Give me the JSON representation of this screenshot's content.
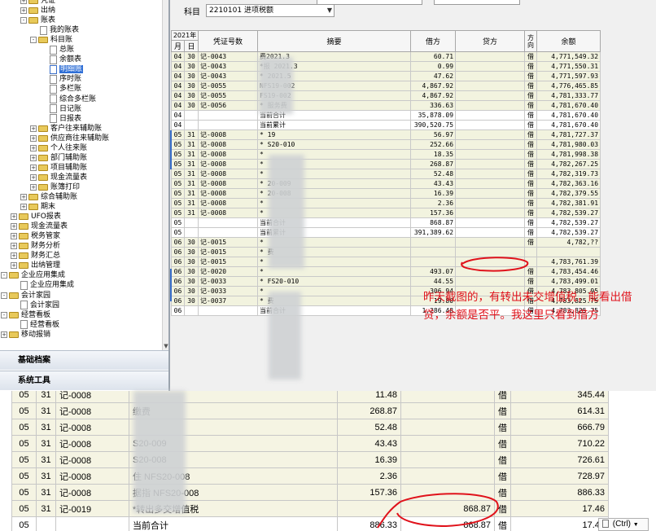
{
  "tree": {
    "items": [
      {
        "label": "凭证",
        "level": 2,
        "expander": "+",
        "icon": "folder-icon"
      },
      {
        "label": "出纳",
        "level": 2,
        "expander": "+",
        "icon": "folder-icon"
      },
      {
        "label": "账表",
        "level": 2,
        "expander": "-",
        "icon": "folder-icon"
      },
      {
        "label": "我的账表",
        "level": 3,
        "expander": "",
        "icon": "document-icon"
      },
      {
        "label": "科目账",
        "level": 3,
        "expander": "-",
        "icon": "folder-icon"
      },
      {
        "label": "总账",
        "level": 4,
        "expander": "",
        "icon": "document-icon"
      },
      {
        "label": "余额表",
        "level": 4,
        "expander": "",
        "icon": "document-icon"
      },
      {
        "label": "明细账",
        "level": 4,
        "expander": "",
        "icon": "document-icon",
        "selected": true
      },
      {
        "label": "序时账",
        "level": 4,
        "expander": "",
        "icon": "document-icon"
      },
      {
        "label": "多栏账",
        "level": 4,
        "expander": "",
        "icon": "document-icon"
      },
      {
        "label": "综合多栏账",
        "level": 4,
        "expander": "",
        "icon": "document-icon"
      },
      {
        "label": "日记账",
        "level": 4,
        "expander": "",
        "icon": "document-icon"
      },
      {
        "label": "日报表",
        "level": 4,
        "expander": "",
        "icon": "document-icon"
      },
      {
        "label": "客户往来辅助账",
        "level": 3,
        "expander": "+",
        "icon": "folder-icon"
      },
      {
        "label": "供应商往来辅助账",
        "level": 3,
        "expander": "+",
        "icon": "folder-icon"
      },
      {
        "label": "个人往来账",
        "level": 3,
        "expander": "+",
        "icon": "folder-icon"
      },
      {
        "label": "部门辅助账",
        "level": 3,
        "expander": "+",
        "icon": "folder-icon"
      },
      {
        "label": "项目辅助账",
        "level": 3,
        "expander": "+",
        "icon": "folder-icon"
      },
      {
        "label": "现金流量表",
        "level": 3,
        "expander": "+",
        "icon": "folder-icon"
      },
      {
        "label": "账簿打印",
        "level": 3,
        "expander": "+",
        "icon": "folder-icon"
      },
      {
        "label": "综合辅助账",
        "level": 2,
        "expander": "+",
        "icon": "folder-icon"
      },
      {
        "label": "期末",
        "level": 2,
        "expander": "+",
        "icon": "folder-icon"
      },
      {
        "label": "UFO报表",
        "level": 1,
        "expander": "+",
        "icon": "folder-icon"
      },
      {
        "label": "现金流量表",
        "level": 1,
        "expander": "+",
        "icon": "folder-icon"
      },
      {
        "label": "税务管家",
        "level": 1,
        "expander": "+",
        "icon": "folder-icon"
      },
      {
        "label": "财务分析",
        "level": 1,
        "expander": "+",
        "icon": "folder-icon"
      },
      {
        "label": "财务汇总",
        "level": 1,
        "expander": "+",
        "icon": "folder-icon"
      },
      {
        "label": "出纳管理",
        "level": 1,
        "expander": "+",
        "icon": "folder-icon"
      },
      {
        "label": "企业应用集成",
        "level": 0,
        "expander": "-",
        "icon": "folder-icon"
      },
      {
        "label": "企业应用集成",
        "level": 1,
        "expander": "",
        "icon": "document-icon"
      },
      {
        "label": "会计家园",
        "level": 0,
        "expander": "-",
        "icon": "folder-icon"
      },
      {
        "label": "会计家园",
        "level": 1,
        "expander": "",
        "icon": "document-icon"
      },
      {
        "label": "经营看板",
        "level": 0,
        "expander": "-",
        "icon": "folder-icon"
      },
      {
        "label": "经营看板",
        "level": 1,
        "expander": "",
        "icon": "document-icon"
      },
      {
        "label": "移动报销",
        "level": 0,
        "expander": "+",
        "icon": "folder-icon"
      }
    ]
  },
  "sections": {
    "basic_files": "基础档案",
    "system_tools": "系统工具"
  },
  "filter": {
    "label": "科目",
    "value": "2210101 进项税额"
  },
  "ledger": {
    "year_header": "2021年",
    "headers": {
      "month": "月",
      "day": "日",
      "voucher": "凭证号数",
      "summary": "摘要",
      "debit": "借方",
      "credit": "贷方",
      "direction": "方向",
      "balance": "余额"
    },
    "rows": [
      {
        "m": "04",
        "d": "30",
        "v": "记-0043",
        "s": "              费2021.3",
        "dr": "60.71",
        "cr": "",
        "dir": "借",
        "bal": "4,771,549.32",
        "kind": "detail"
      },
      {
        "m": "04",
        "d": "30",
        "v": "记-0043",
        "s": "*报            2021.3",
        "dr": "0.99",
        "cr": "",
        "dir": "借",
        "bal": "4,771,550.31",
        "kind": "detail"
      },
      {
        "m": "04",
        "d": "30",
        "v": "记-0043",
        "s": "*           2021.5",
        "dr": "47.62",
        "cr": "",
        "dir": "借",
        "bal": "4,771,597.93",
        "kind": "detail"
      },
      {
        "m": "04",
        "d": "30",
        "v": "记-0055",
        "s": "              NFS19-002",
        "dr": "4,867.92",
        "cr": "",
        "dir": "借",
        "bal": "4,776,465.85",
        "kind": "detail"
      },
      {
        "m": "04",
        "d": "30",
        "v": "记-0055",
        "s": "              FS19-002",
        "dr": "4,867.92",
        "cr": "",
        "dir": "借",
        "bal": "4,781,333.77",
        "kind": "detail"
      },
      {
        "m": "04",
        "d": "30",
        "v": "记-0056",
        "s": "*              服务费",
        "dr": "336.63",
        "cr": "",
        "dir": "借",
        "bal": "4,781,670.40",
        "kind": "detail"
      },
      {
        "m": "04",
        "d": "",
        "v": "",
        "s": "当前合计",
        "dr": "35,878.09",
        "cr": "",
        "dir": "借",
        "bal": "4,781,670.40",
        "kind": "summary"
      },
      {
        "m": "04",
        "d": "",
        "v": "",
        "s": "当前累计",
        "dr": "390,520.75",
        "cr": "",
        "dir": "借",
        "bal": "4,781,670.40",
        "kind": "summary"
      },
      {
        "m": "05",
        "d": "31",
        "v": "记-0008",
        "s": "*              19",
        "dr": "56.97",
        "cr": "",
        "dir": "借",
        "bal": "4,781,727.37",
        "kind": "detail"
      },
      {
        "m": "05",
        "d": "31",
        "v": "记-0008",
        "s": "*            S20-010",
        "dr": "252.66",
        "cr": "",
        "dir": "借",
        "bal": "4,781,980.03",
        "kind": "detail"
      },
      {
        "m": "05",
        "d": "31",
        "v": "记-0008",
        "s": "*",
        "dr": "18.35",
        "cr": "",
        "dir": "借",
        "bal": "4,781,998.38",
        "kind": "detail"
      },
      {
        "m": "05",
        "d": "31",
        "v": "记-0008",
        "s": "*",
        "dr": "268.87",
        "cr": "",
        "dir": "借",
        "bal": "4,782,267.25",
        "kind": "detail"
      },
      {
        "m": "05",
        "d": "31",
        "v": "记-0008",
        "s": "*",
        "dr": "52.48",
        "cr": "",
        "dir": "借",
        "bal": "4,782,319.73",
        "kind": "detail"
      },
      {
        "m": "05",
        "d": "31",
        "v": "记-0008",
        "s": "*            20-009",
        "dr": "43.43",
        "cr": "",
        "dir": "借",
        "bal": "4,782,363.16",
        "kind": "detail"
      },
      {
        "m": "05",
        "d": "31",
        "v": "记-0008",
        "s": "*            20-008",
        "dr": "16.39",
        "cr": "",
        "dir": "借",
        "bal": "4,782,379.55",
        "kind": "detail"
      },
      {
        "m": "05",
        "d": "31",
        "v": "记-0008",
        "s": "*",
        "dr": "2.36",
        "cr": "",
        "dir": "借",
        "bal": "4,782,381.91",
        "kind": "detail"
      },
      {
        "m": "05",
        "d": "31",
        "v": "记-0008",
        "s": "*",
        "dr": "157.36",
        "cr": "",
        "dir": "借",
        "bal": "4,782,539.27",
        "kind": "detail"
      },
      {
        "m": "05",
        "d": "",
        "v": "",
        "s": "当前合计",
        "dr": "868.87",
        "cr": "",
        "dir": "借",
        "bal": "4,782,539.27",
        "kind": "summary"
      },
      {
        "m": "05",
        "d": "",
        "v": "",
        "s": "当前累计",
        "dr": "391,389.62",
        "cr": "",
        "dir": "借",
        "bal": "4,782,539.27",
        "kind": "summary"
      },
      {
        "m": "06",
        "d": "30",
        "v": "记-0015",
        "s": "*",
        "dr": "",
        "cr": "",
        "dir": "借",
        "bal": "4,782,??",
        "kind": "detail"
      },
      {
        "m": "06",
        "d": "30",
        "v": "记-0015",
        "s": "*          费",
        "dr": "",
        "cr": "",
        "dir": "",
        "bal": "",
        "kind": "detail"
      },
      {
        "m": "06",
        "d": "30",
        "v": "记-0015",
        "s": "*",
        "dr": "",
        "cr": "",
        "dir": "",
        "bal": "4,783,761.39",
        "kind": "detail"
      },
      {
        "m": "06",
        "d": "30",
        "v": "记-0020",
        "s": "*",
        "dr": "493.07",
        "cr": "",
        "dir": "借",
        "bal": "4,783,454.46",
        "kind": "detail"
      },
      {
        "m": "06",
        "d": "30",
        "v": "记-0033",
        "s": "*           FS20-010",
        "dr": "44.55",
        "cr": "",
        "dir": "借",
        "bal": "4,783,499.01",
        "kind": "detail"
      },
      {
        "m": "06",
        "d": "30",
        "v": "记-0033",
        "s": "*",
        "dr": "306.94",
        "cr": "",
        "dir": "借",
        "bal": "4,783,805.95",
        "kind": "detail"
      },
      {
        "m": "06",
        "d": "30",
        "v": "记-0037",
        "s": "*               费",
        "dr": "19.80",
        "cr": "",
        "dir": "借",
        "bal": "4,783,825.75",
        "kind": "detail"
      },
      {
        "m": "06",
        "d": "",
        "v": "",
        "s": "当前合计",
        "dr": "1,286.48",
        "cr": "",
        "dir": "借",
        "bal": "4,783,825.75",
        "kind": "summary"
      }
    ]
  },
  "zoomed": {
    "rows": [
      {
        "m": "05",
        "d": "31",
        "v": "记-0008",
        "s": "",
        "dr": "11.48",
        "cr": "",
        "dir": "借",
        "bal": "345.44",
        "kind": "detail"
      },
      {
        "m": "05",
        "d": "31",
        "v": "记-0008",
        "s": "           缴费",
        "dr": "268.87",
        "cr": "",
        "dir": "借",
        "bal": "614.31",
        "kind": "detail"
      },
      {
        "m": "05",
        "d": "31",
        "v": "记-0008",
        "s": "",
        "dr": "52.48",
        "cr": "",
        "dir": "借",
        "bal": "666.79",
        "kind": "detail"
      },
      {
        "m": "05",
        "d": "31",
        "v": "记-0008",
        "s": "          S20-009",
        "dr": "43.43",
        "cr": "",
        "dir": "借",
        "bal": "710.22",
        "kind": "detail"
      },
      {
        "m": "05",
        "d": "31",
        "v": "记-0008",
        "s": "          S20-008",
        "dr": "16.39",
        "cr": "",
        "dir": "借",
        "bal": "726.61",
        "kind": "detail"
      },
      {
        "m": "05",
        "d": "31",
        "v": "记-0008",
        "s": "         住  NFS20-008",
        "dr": "2.36",
        "cr": "",
        "dir": "借",
        "bal": "728.97",
        "kind": "detail"
      },
      {
        "m": "05",
        "d": "31",
        "v": "记-0008",
        "s": "       据指  NFS20-008",
        "dr": "157.36",
        "cr": "",
        "dir": "借",
        "bal": "886.33",
        "kind": "detail"
      },
      {
        "m": "05",
        "d": "31",
        "v": "记-0019",
        "s": "*转出多交增值税",
        "dr": "",
        "cr": "868.87",
        "dir": "借",
        "bal": "17.46",
        "kind": "detail"
      },
      {
        "m": "05",
        "d": "",
        "v": "",
        "s": "当前合计",
        "dr": "886.33",
        "cr": "868.87",
        "dir": "借",
        "bal": "17.46",
        "kind": "summary"
      }
    ],
    "paste_hint": "(Ctrl)"
  },
  "annotation": {
    "text": "昨天截图的，有转出未交增值税，能看出借贷，余额是否平。我这里只看到借方",
    "color": "#e0121b"
  }
}
